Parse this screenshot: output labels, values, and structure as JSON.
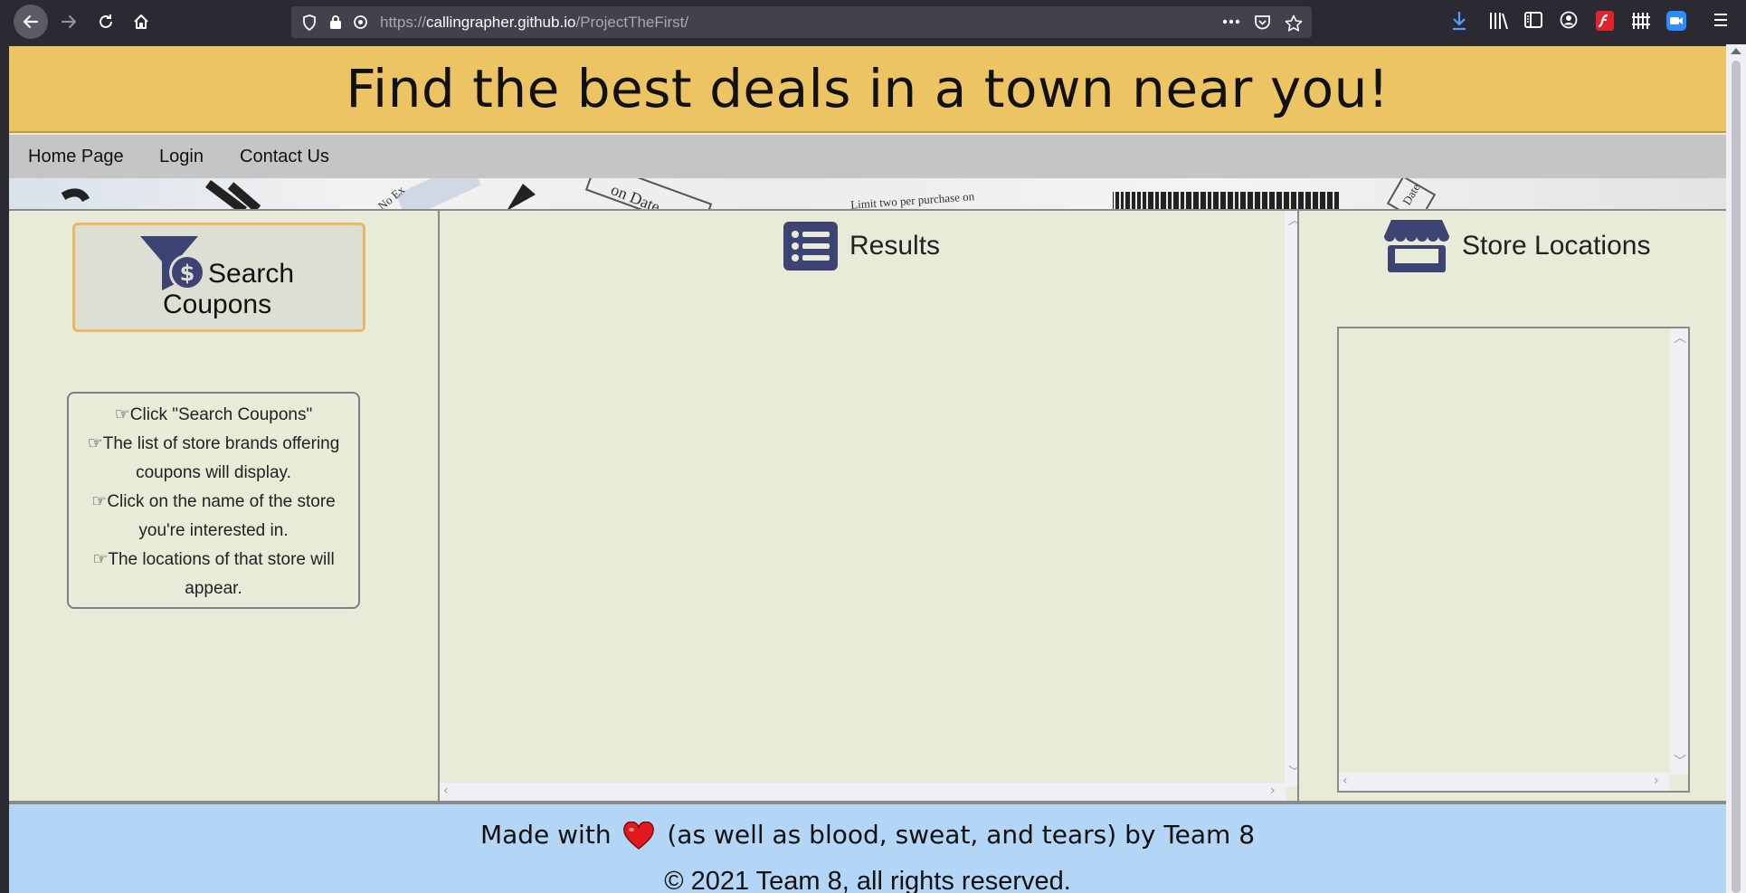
{
  "browser": {
    "url_protocol": "https://",
    "url_host": "callingrapher.github.io",
    "url_path": "/ProjectTheFirst/"
  },
  "header": {
    "title": "Find the best deals in a town near you!"
  },
  "nav": {
    "items": [
      "Home Page",
      "Login",
      "Contact Us"
    ]
  },
  "banner": {
    "fragments": [
      "No Ex",
      "on Date",
      "Limit two per purchase on",
      "Date"
    ]
  },
  "left_panel": {
    "search_button": {
      "line1": "Search",
      "line2": "Coupons"
    },
    "instructions": [
      "Click \"Search Coupons\"",
      "The list of store brands offering coupons will display.",
      "Click on the name of the store you're interested in.",
      "The locations of that store will appear."
    ]
  },
  "results_panel": {
    "title": "Results"
  },
  "store_panel": {
    "title": "Store Locations"
  },
  "footer": {
    "made_with_prefix": "Made with",
    "made_with_suffix": "(as well as blood, sweat, and tears) by Team 8",
    "copyright": "© 2021 Team 8, all rights reserved."
  },
  "colors": {
    "header_bg": "#ecc463",
    "nav_bg": "#c5c5c5",
    "panel_bg": "#e8ebd8",
    "footer_bg": "#b3d6f6",
    "icon_navy": "#3d4473",
    "search_border": "#e8b866"
  }
}
